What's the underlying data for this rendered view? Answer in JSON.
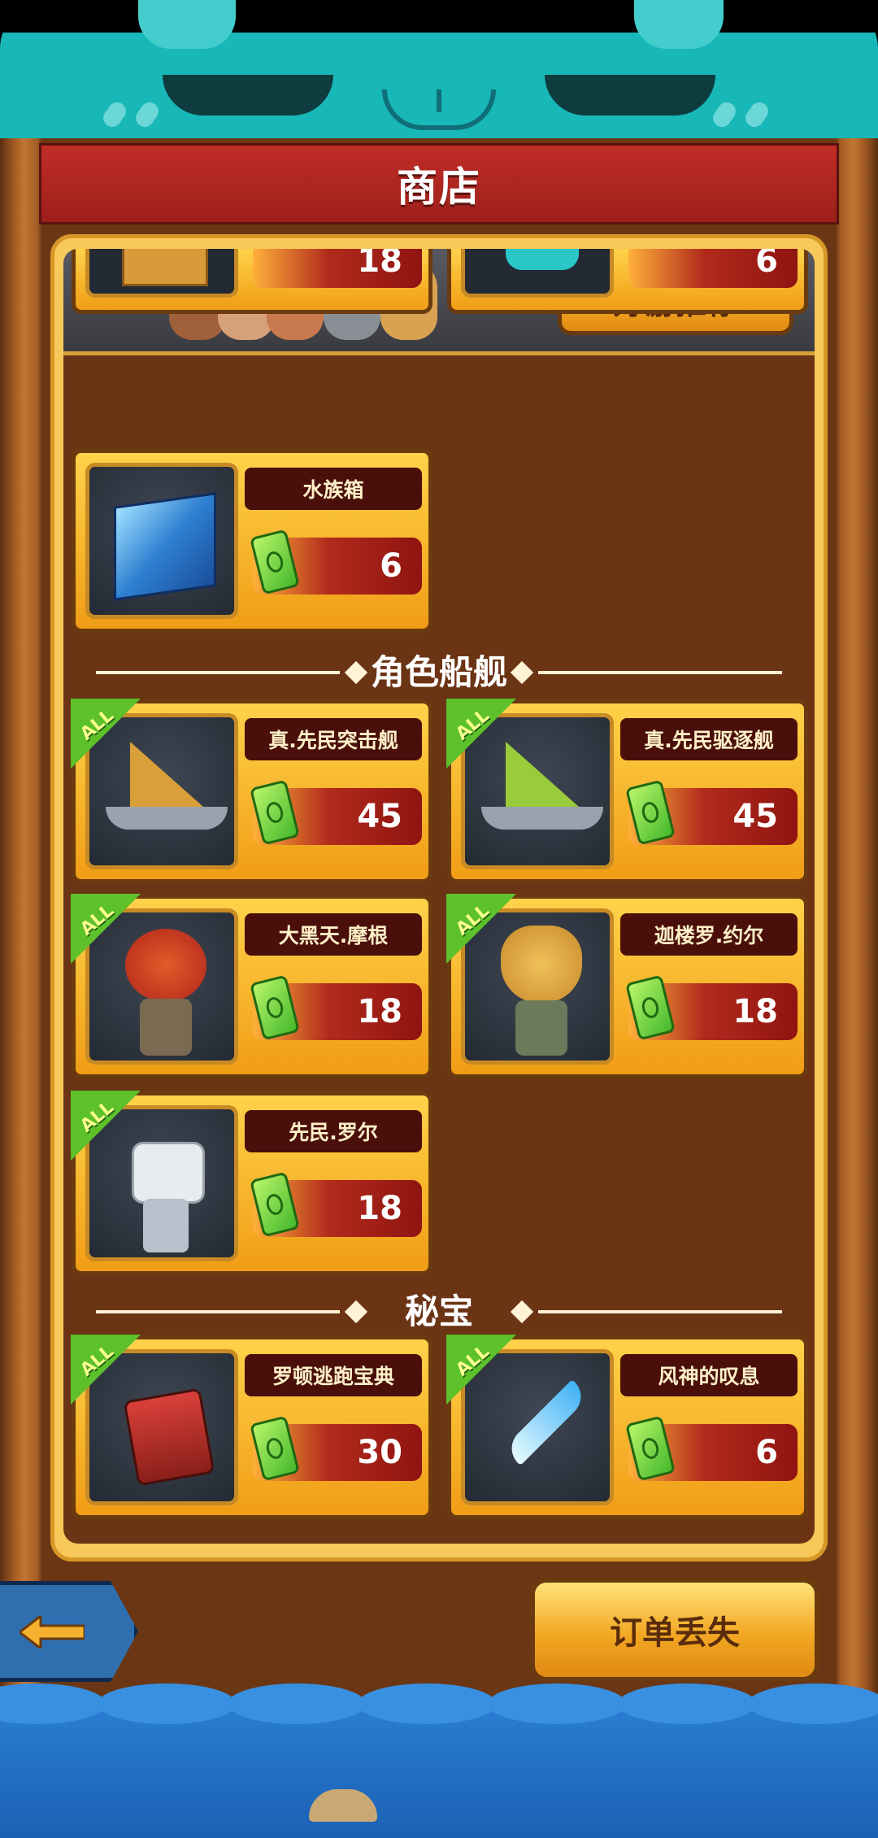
{
  "title": "商店",
  "banner": {
    "recommend_label": "好游推荐"
  },
  "partial_items": [
    {
      "price": "18"
    },
    {
      "price": "6"
    }
  ],
  "items": [
    {
      "name": "水族箱",
      "price": "6"
    }
  ],
  "sections": [
    {
      "title": "角色船舰",
      "items": [
        {
          "name": "真.先民突击舰",
          "price": "45",
          "badge": "ALL"
        },
        {
          "name": "真.先民驱逐舰",
          "price": "45",
          "badge": "ALL"
        },
        {
          "name": "大黑天.摩根",
          "price": "18",
          "badge": "ALL"
        },
        {
          "name": "迦楼罗.约尔",
          "price": "18",
          "badge": "ALL"
        },
        {
          "name": "先民.罗尔",
          "price": "18",
          "badge": "ALL"
        }
      ]
    },
    {
      "title": "秘宝",
      "items": [
        {
          "name": "罗顿逃跑宝典",
          "price": "30",
          "badge": "ALL"
        },
        {
          "name": "风神的叹息",
          "price": "6",
          "badge": "ALL"
        }
      ]
    }
  ],
  "bottom": {
    "order_lost_label": "订单丢失"
  },
  "colors": {
    "teal": "#18b7b8",
    "header_red": "#c22d27",
    "gold": "#f2a823",
    "panel_brown": "#6b3415"
  }
}
